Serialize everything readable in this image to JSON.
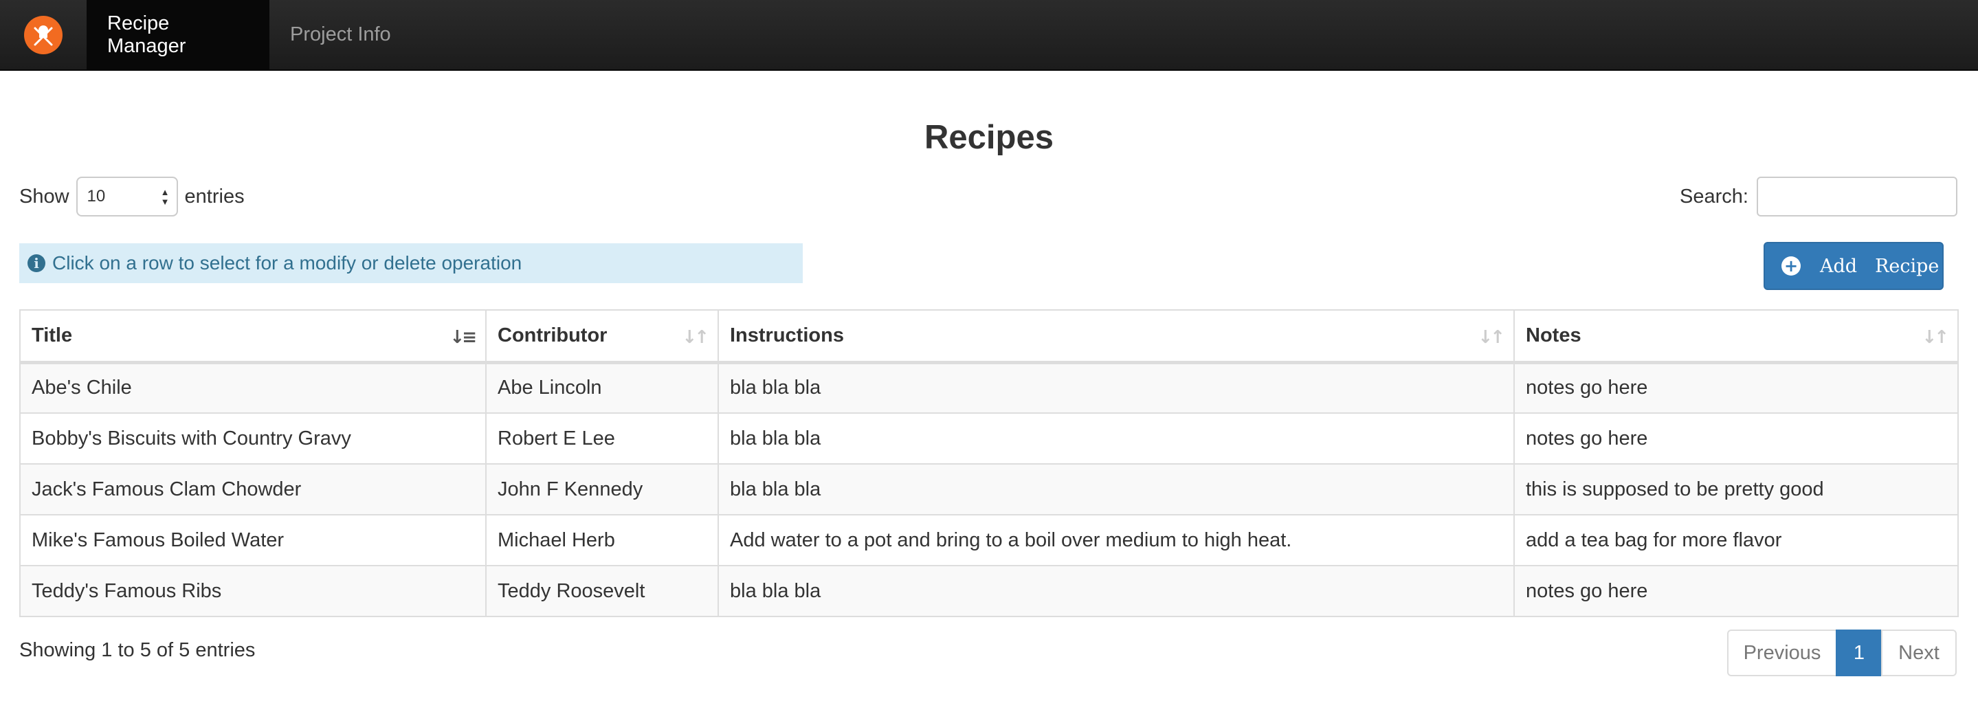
{
  "navbar": {
    "brand_icon": "chef-logo-icon",
    "items": [
      {
        "label": "Recipe Manager",
        "active": true
      },
      {
        "label": "Project Info",
        "active": false
      }
    ]
  },
  "page": {
    "title": "Recipes"
  },
  "length": {
    "show_label": "Show",
    "value": "10",
    "entries_label": "entries"
  },
  "search": {
    "label": "Search:",
    "value": ""
  },
  "alert": {
    "icon": "info-icon",
    "text": "Click on a row to select for a modify or delete operation"
  },
  "add_button": {
    "icon": "plus-circle-icon",
    "word1": "Add",
    "word2": "Recipe"
  },
  "table": {
    "columns": [
      "Title",
      "Contributor",
      "Instructions",
      "Notes"
    ],
    "sorted_column": "Title",
    "rows": [
      [
        "Abe's Chile",
        "Abe Lincoln",
        "bla bla bla",
        "notes go here"
      ],
      [
        "Bobby's Biscuits with Country Gravy",
        "Robert E Lee",
        "bla bla bla",
        "notes go here"
      ],
      [
        "Jack's Famous Clam Chowder",
        "John F Kennedy",
        "bla bla bla",
        "this is supposed to be pretty good"
      ],
      [
        "Mike's Famous Boiled Water",
        "Michael Herb",
        "Add water to a pot and bring to a boil over medium to high heat.",
        "add a tea bag for more flavor"
      ],
      [
        "Teddy's Famous Ribs",
        "Teddy Roosevelt",
        "bla bla bla",
        "notes go here"
      ]
    ]
  },
  "footer": {
    "info": "Showing 1 to 5 of 5 entries",
    "prev": "Previous",
    "current_page": "1",
    "next": "Next"
  },
  "colors": {
    "navbar_bg": "#222222",
    "accent": "#337ab7",
    "logo": "#f26b21",
    "alert_bg": "#d9edf7",
    "alert_text": "#31708f"
  }
}
